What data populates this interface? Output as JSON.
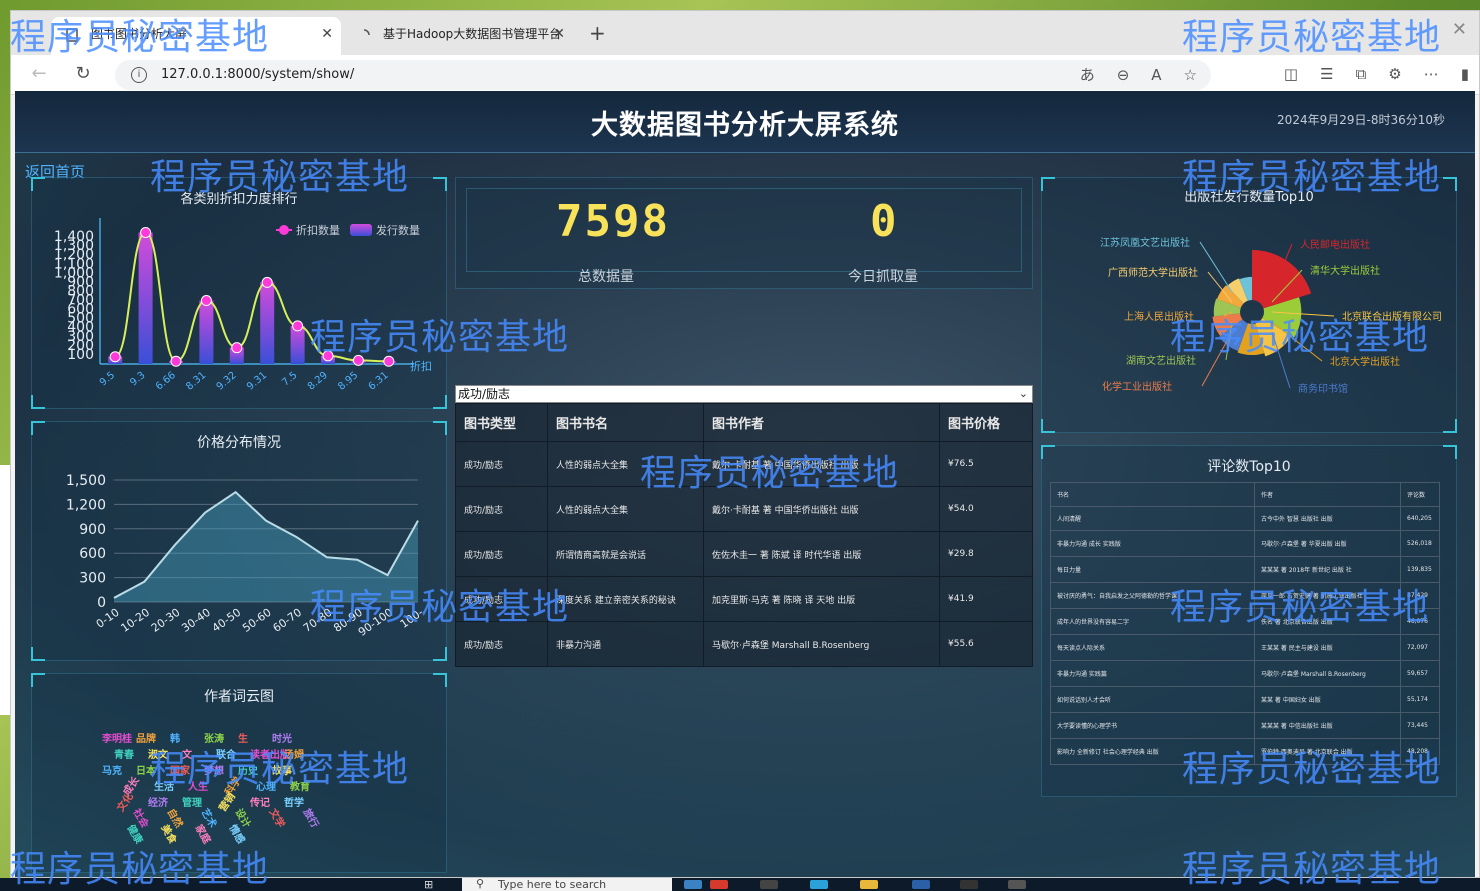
{
  "browser": {
    "tabs": [
      {
        "label": "图书图书分析大屏",
        "active": true
      },
      {
        "label": "基于Hadoop大数据图书管理平台",
        "active": false
      }
    ],
    "url": "127.0.0.1:8000/system/show/"
  },
  "dashboard": {
    "title": "大数据图书分析大屏系统",
    "datetime": "2024年9月29日-8时36分10秒",
    "back_link": "返回首页",
    "stats": {
      "total_value": "7598",
      "total_label": "总数据量",
      "today_value": "0",
      "today_label": "今日抓取量"
    },
    "discount_panel": {
      "title": "各类别折扣力度排行",
      "legend": [
        "折扣数量",
        "发行数量"
      ],
      "axis_name": "折扣"
    },
    "price_panel": {
      "title": "价格分布情况"
    },
    "wordcloud_panel": {
      "title": "作者词云图",
      "words": [
        "李明桂",
        "品牌",
        "韩",
        "张涛",
        "生",
        "时光",
        "青春",
        "淑文",
        "文",
        "联合",
        "读者出版",
        "汤姆",
        "马克",
        "日本",
        "国家",
        "梦想",
        "历史",
        "故事",
        "成长",
        "生活",
        "人生",
        "科学",
        "心理",
        "教育",
        "文化",
        "经济",
        "管理",
        "营销",
        "传记",
        "哲学",
        "社会",
        "自然",
        "艺术",
        "设计",
        "文学",
        "旅行",
        "健康",
        "美食",
        "家庭",
        "情感"
      ]
    },
    "publisher_panel": {
      "title": "出版社发行数量Top10",
      "labels": [
        "江苏凤凰文艺出版社",
        "广西师范大学出版社",
        "上海人民出版社",
        "湖南文艺出版社",
        "化学工业出版社",
        "人民邮电出版社",
        "清华大学出版社",
        "北京联合出版有限公司",
        "北京大学出版社",
        "商务印书馆"
      ]
    },
    "category_select": {
      "value": "成功/励志"
    },
    "book_table": {
      "headers": [
        "图书类型",
        "图书书名",
        "图书作者",
        "图书价格"
      ],
      "rows": [
        [
          "成功/励志",
          "人性的弱点大全集",
          "戴尔·卡耐基 著 中国华侨出版社 出版",
          "¥76.5"
        ],
        [
          "成功/励志",
          "人性的弱点大全集",
          "戴尔·卡耐基 著 中国华侨出版社 出版",
          "¥54.0"
        ],
        [
          "成功/励志",
          "所谓情商高就是会说话",
          "佐佐木圭一 著 陈斌 译 时代华语 出版",
          "¥29.8"
        ],
        [
          "成功/励志",
          "深度关系 建立亲密关系的秘诀",
          "加克里斯·马克 著 陈晓 译 天地 出版",
          "¥41.9"
        ],
        [
          "成功/励志",
          "非暴力沟通",
          "马歇尔·卢森堡 Marshall B.Rosenberg",
          "¥55.6"
        ]
      ]
    },
    "review_panel": {
      "title": "评论数Top10",
      "headers": [
        "书名",
        "作者",
        "评论数"
      ],
      "rows": [
        [
          "人间清醒",
          "古今中外 智慧 出版社 出版",
          "640,205"
        ],
        [
          "非暴力沟通 成长 实践版",
          "马歇尔·卢森堡 著 华夏出版 出版",
          "526,018"
        ],
        [
          "每日力量",
          "某某某 著 2018年 新世纪 出版 社",
          "139,835"
        ],
        [
          "被讨厌的勇气：自我启发之父阿德勒的哲学课",
          "岸见一郎 古贺史健 著 机械工业出版社",
          "87,429"
        ],
        [
          "成年人的世界没有容易二字",
          "佚名 著 北京联合出版 出版",
          "46,076"
        ],
        [
          "每天读点人际关系",
          "王某某 著 民主与建设 出版",
          "72,097"
        ],
        [
          "非暴力沟通 实践篇",
          "马歇尔·卢森堡 Marshall B.Rosenberg",
          "59,657"
        ],
        [
          "如何说话别人才会听",
          "某某 著 中国妇女 出版",
          "55,174"
        ],
        [
          "大学要读懂的心理学书",
          "某某某 著 中信出版社 出版",
          "73,445"
        ],
        [
          "影响力 全新修订 社会心理学经典 出版",
          "罗伯特·西奥迪尼 著 北京联合 出版",
          "48,208"
        ]
      ]
    }
  },
  "chart_data": [
    {
      "type": "bar",
      "title": "各类别折扣力度排行",
      "categories": [
        "9.5",
        "9.3",
        "6.66",
        "8.31",
        "9.32",
        "9.31",
        "7.5",
        "8.29",
        "8.95",
        "6.31"
      ],
      "series": [
        {
          "name": "折扣数量",
          "values": [
            80,
            1450,
            30,
            700,
            180,
            900,
            420,
            90,
            40,
            30
          ]
        },
        {
          "name": "发行数量",
          "values": [
            80,
            1450,
            30,
            700,
            180,
            900,
            420,
            90,
            40,
            30
          ]
        }
      ],
      "yticks": [
        "100",
        "200",
        "300",
        "400",
        "500",
        "600",
        "700",
        "800",
        "900",
        "1,000",
        "1,100",
        "1,200",
        "1,300",
        "1,400"
      ],
      "ylim": [
        0,
        1500
      ]
    },
    {
      "type": "area",
      "title": "价格分布情况",
      "categories": [
        "0-10",
        "10-20",
        "20-30",
        "30-40",
        "40-50",
        "50-60",
        "60-70",
        "70-80",
        "80-90",
        "90-100",
        "100-"
      ],
      "values": [
        50,
        250,
        700,
        1100,
        1350,
        1000,
        800,
        550,
        520,
        330,
        1000
      ],
      "yticks": [
        "0",
        "300",
        "600",
        "900",
        "1,200",
        "1,500"
      ],
      "ylim": [
        0,
        1500
      ]
    },
    {
      "type": "pie",
      "title": "出版社发行数量Top10",
      "categories": [
        "人民邮电出版社",
        "清华大学出版社",
        "北京联合出版有限公司",
        "北京大学出版社",
        "商务印书馆",
        "化学工业出版社",
        "湖南文艺出版社",
        "上海人民出版社",
        "广西师范大学出版社",
        "江苏凤凰文艺出版社"
      ],
      "values": [
        120,
        80,
        70,
        60,
        55,
        50,
        45,
        42,
        38,
        35
      ],
      "colors": [
        "#d7262b",
        "#9ccd38",
        "#f6c445",
        "#e3a21e",
        "#4c7bd0",
        "#ec7b4b",
        "#9cc556",
        "#f2a93b",
        "#f6ce6c",
        "#6cc3d8"
      ]
    }
  ],
  "taskbar": {
    "search_placeholder": "Type here to search"
  },
  "watermark": {
    "text": "程序员秘密基地"
  },
  "colors": {
    "accent": "#35c4d8",
    "number": "#f7e25a",
    "watermark": "#468cff"
  }
}
